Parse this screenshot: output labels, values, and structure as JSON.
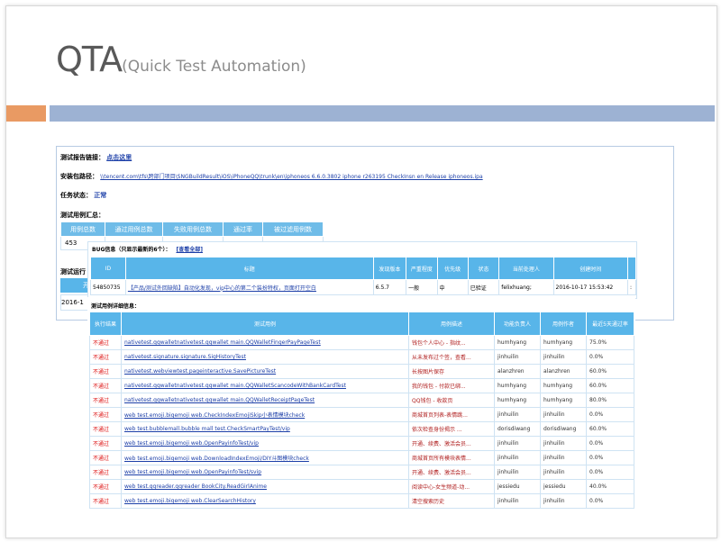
{
  "title": {
    "main": "QTA",
    "sub": "(Quick Test Automation)"
  },
  "report": {
    "link_label": "测试报告链接：",
    "link_text": "点击这里",
    "pkg_label": "安装包路径：",
    "pkg_path": "\\\\tencent.com\\tfs\\跨部门项目\\SNGBuildResult\\iOS\\iPhoneQQ\\trunk\\en\\iphoneos 6.6.0.3802 iphone r263195 CheckInsn en Release iphoneos.ipa",
    "status_label": "任务状态：",
    "status_value": "正常",
    "summary_label": "测试用例汇总：",
    "summary_headers": [
      "用例总数",
      "通过用例总数",
      "失败用例总数",
      "通过率",
      "被过滤用例数"
    ],
    "summary_first": "453",
    "run_label": "测试运行",
    "run_cell1": "开",
    "run_cell2": "2016-1"
  },
  "bug": {
    "title": "BUG信息（只显示最新的6个）：",
    "view_all": "[查看全部]",
    "headers": [
      "ID",
      "标题",
      "发现版本",
      "严重程度",
      "优先级",
      "状态",
      "当前处理人",
      "创建时间"
    ],
    "row": [
      "54850735",
      "【产品/测试外回缺陷】自动化发现，vip中心的第二个装扮特权，页面打开空白",
      "6.5.7",
      "一般",
      "中",
      "已验证",
      "felixhuang;",
      "2016-10-17 15:53:42",
      ":"
    ]
  },
  "cases": {
    "title": "测试用例详细信息：",
    "headers": [
      "执行结果",
      "测试用例",
      "用例描述",
      "功能负责人",
      "用例作者",
      "最近5天通过率"
    ],
    "rows": [
      [
        "不通过",
        "nativetest.qqwalletnativetest.qqwallet main.QQWalletFingerPayPageTest",
        "钱包个人中心 - 指纹...",
        "humhyang",
        "humhyang",
        "75.0%"
      ],
      [
        "不通过",
        "nativetest.signature.signature.SigHistoryTest",
        "从未发布过个签，查看...",
        "jinhuilin",
        "jinhuilin",
        "0.0%"
      ],
      [
        "不通过",
        "nativetest.webviewtest.pageinteractive.SavePictureTest",
        "长按图片保存",
        "alanzhren",
        "alanzhren",
        "60.0%"
      ],
      [
        "不通过",
        "nativetest.qqwalletnativetest.qqwallet main.QQWalletScancodeWithBankCardTest",
        "我的钱包 - 付款已绑...",
        "humhyang",
        "humhyang",
        "60.0%"
      ],
      [
        "不通过",
        "nativetest.qqwalletnativetest.qqwallet main.QQWalletReceiptPageTest",
        "QQ钱包 - 收款页",
        "humhyang",
        "humhyang",
        "80.0%"
      ],
      [
        "不通过",
        "web test.emoji.biqemoji web.CheckIndexEmojiSkip小表情模块check",
        "商城首页列表-表情跳...",
        "jinhuilin",
        "jinhuilin",
        "0.0%"
      ],
      [
        "不通过",
        "web test.bubblemall.bubble mall test.CheckSmartPayTest/vip",
        "依次检查身份揭示 ...",
        "dorisdiwang",
        "dorisdiwang",
        "60.0%"
      ],
      [
        "不通过",
        "web test.emoji.biqemoji web.OpenPayinfoTest/vip",
        "开通、续费、激活会员...",
        "jinhuilin",
        "jinhuilin",
        "0.0%"
      ],
      [
        "不通过",
        "web test.emoji.biqemoji web.DownloadIndexEmoji/DIY斗图模块check",
        "商城首页所有模块表情...",
        "jinhuilin",
        "jinhuilin",
        "0.0%"
      ],
      [
        "不通过",
        "web test.emoji.biqemoji web.OpenPayinfoTest/svip",
        "开通、续费、激活会员...",
        "jinhuilin",
        "jinhuilin",
        "0.0%"
      ],
      [
        "不通过",
        "web test.qqreader.qqreader BookCity.ReadGirlAnime",
        "阅读中心-女生频道-动...",
        "jessiedu",
        "jessiedu",
        "40.0%"
      ],
      [
        "不通过",
        "web test.emoji.biqemoji web.ClearSearchHistory",
        "清空搜索历史",
        "jinhuilin",
        "jinhuilin",
        "0.0%"
      ]
    ]
  },
  "colors": {
    "header_blue": "#58b5e9",
    "accent_orange": "#e99a63",
    "bar_blue": "#9db2d3",
    "fail_red": "#dd1111",
    "link_blue": "#1c3fa8"
  }
}
